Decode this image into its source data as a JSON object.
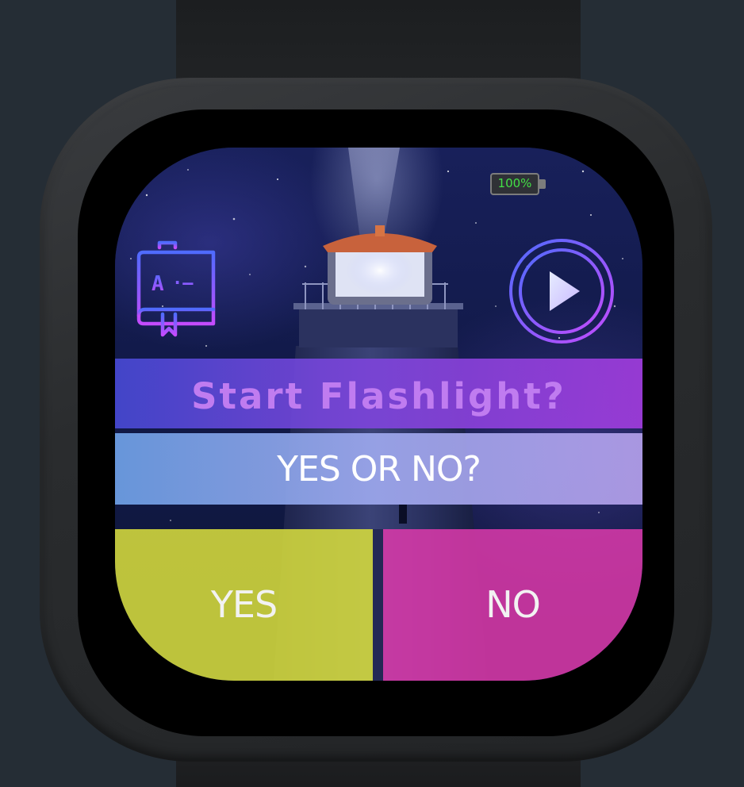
{
  "device": "smartwatch",
  "battery": {
    "level_text": "100%",
    "level": 100,
    "color": "#43e046"
  },
  "icons": {
    "left": "morse-book-icon",
    "right": "play-icon",
    "book_letter": "A",
    "book_morse": "·–"
  },
  "prompt": {
    "title": "Start Flashlight?",
    "subtitle": "YES OR NO?"
  },
  "buttons": {
    "yes_label": "YES",
    "no_label": "NO"
  },
  "colors": {
    "title_banner": "#8a46dc",
    "title_text": "#c07cf0",
    "subtitle_banner": "#9fb0ee",
    "yes": "#d6dc3c",
    "no": "#de3aac",
    "icon_gradient_start": "#4f6bff",
    "icon_gradient_end": "#c44bff"
  }
}
